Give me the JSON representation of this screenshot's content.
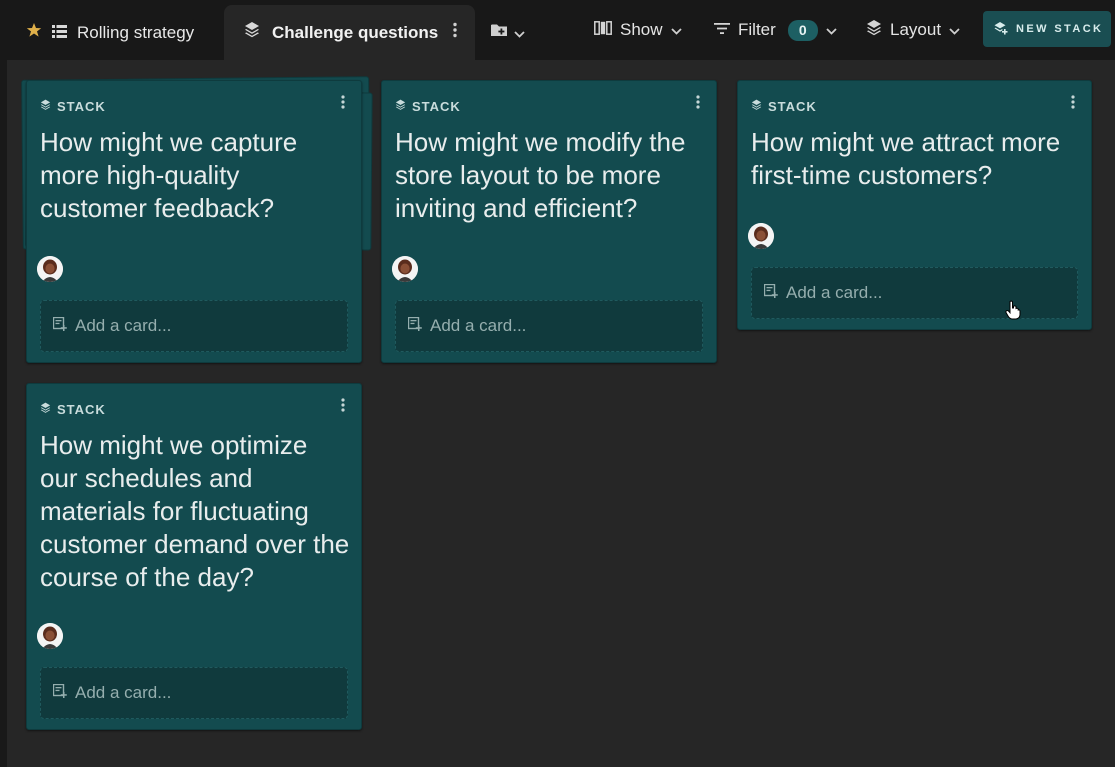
{
  "tabs": {
    "rolling": {
      "label": "Rolling strategy",
      "icon": "star-icon"
    },
    "active": {
      "label": "Challenge questions",
      "icon": "layers-icon"
    }
  },
  "toolbar": {
    "show_label": "Show",
    "filter_label": "Filter",
    "filter_count": "0",
    "layout_label": "Layout",
    "new_stack_label": "NEW STACK"
  },
  "stack_label": "STACK",
  "add_card_placeholder": "Add a card...",
  "stacks": [
    {
      "title": "How might we capture more high-quality customer feedback?"
    },
    {
      "title": "How might we modify the store layout to be more inviting and efficient?"
    },
    {
      "title": "How might we attract more first-time customers?"
    },
    {
      "title": "How might we optimize our schedules and materials for fluctuating customer demand over the course of the day?"
    }
  ],
  "colors": {
    "accent": "#1d5f63",
    "stack_bg": "#134b4f",
    "board_bg": "#262626",
    "star": "#e0b04a"
  }
}
